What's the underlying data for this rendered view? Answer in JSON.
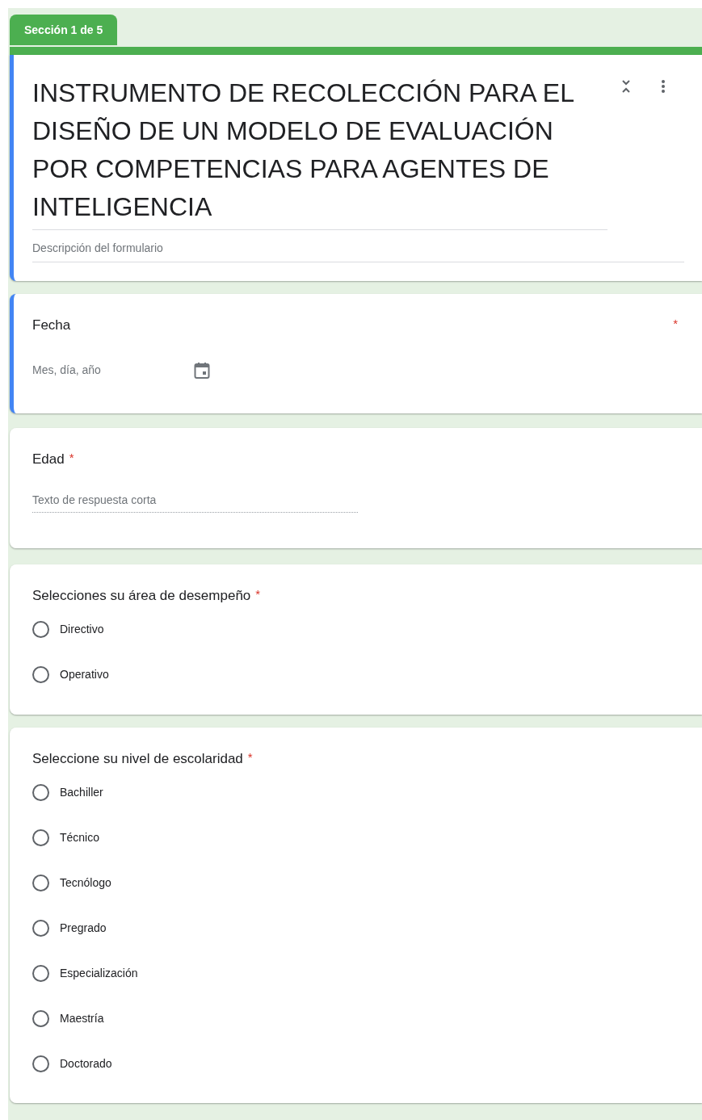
{
  "section_tab": {
    "label": "Sección 1 de 5"
  },
  "header": {
    "title": "INSTRUMENTO DE RECOLECCIÓN PARA EL DISEÑO DE UN MODELO DE EVALUACIÓN POR COMPETENCIAS PARA AGENTES DE INTELIGENCIA",
    "description_placeholder": "Descripción del formulario",
    "active": true
  },
  "questions": [
    {
      "kind": "date",
      "title": "Fecha",
      "required": "*",
      "active": true,
      "placeholder": "Mes, día, año"
    },
    {
      "kind": "short_answer",
      "title": "Edad",
      "required": "*",
      "active": false,
      "placeholder": "Texto de respuesta corta"
    },
    {
      "kind": "radio",
      "title": "Selecciones su área de desempeño",
      "required": "*",
      "active": false,
      "options": [
        {
          "label": "Directivo",
          "selected": false
        },
        {
          "label": "Operativo",
          "selected": false
        }
      ]
    },
    {
      "kind": "radio",
      "title": "Seleccione su nivel de escolaridad",
      "required": "*",
      "active": false,
      "options": [
        {
          "label": "Bachiller",
          "selected": false
        },
        {
          "label": "Técnico",
          "selected": false
        },
        {
          "label": "Tecnólogo",
          "selected": false
        },
        {
          "label": "Pregrado",
          "selected": false
        },
        {
          "label": "Especialización",
          "selected": false
        },
        {
          "label": "Maestría",
          "selected": false
        },
        {
          "label": "Doctorado",
          "selected": false
        }
      ]
    }
  ]
}
